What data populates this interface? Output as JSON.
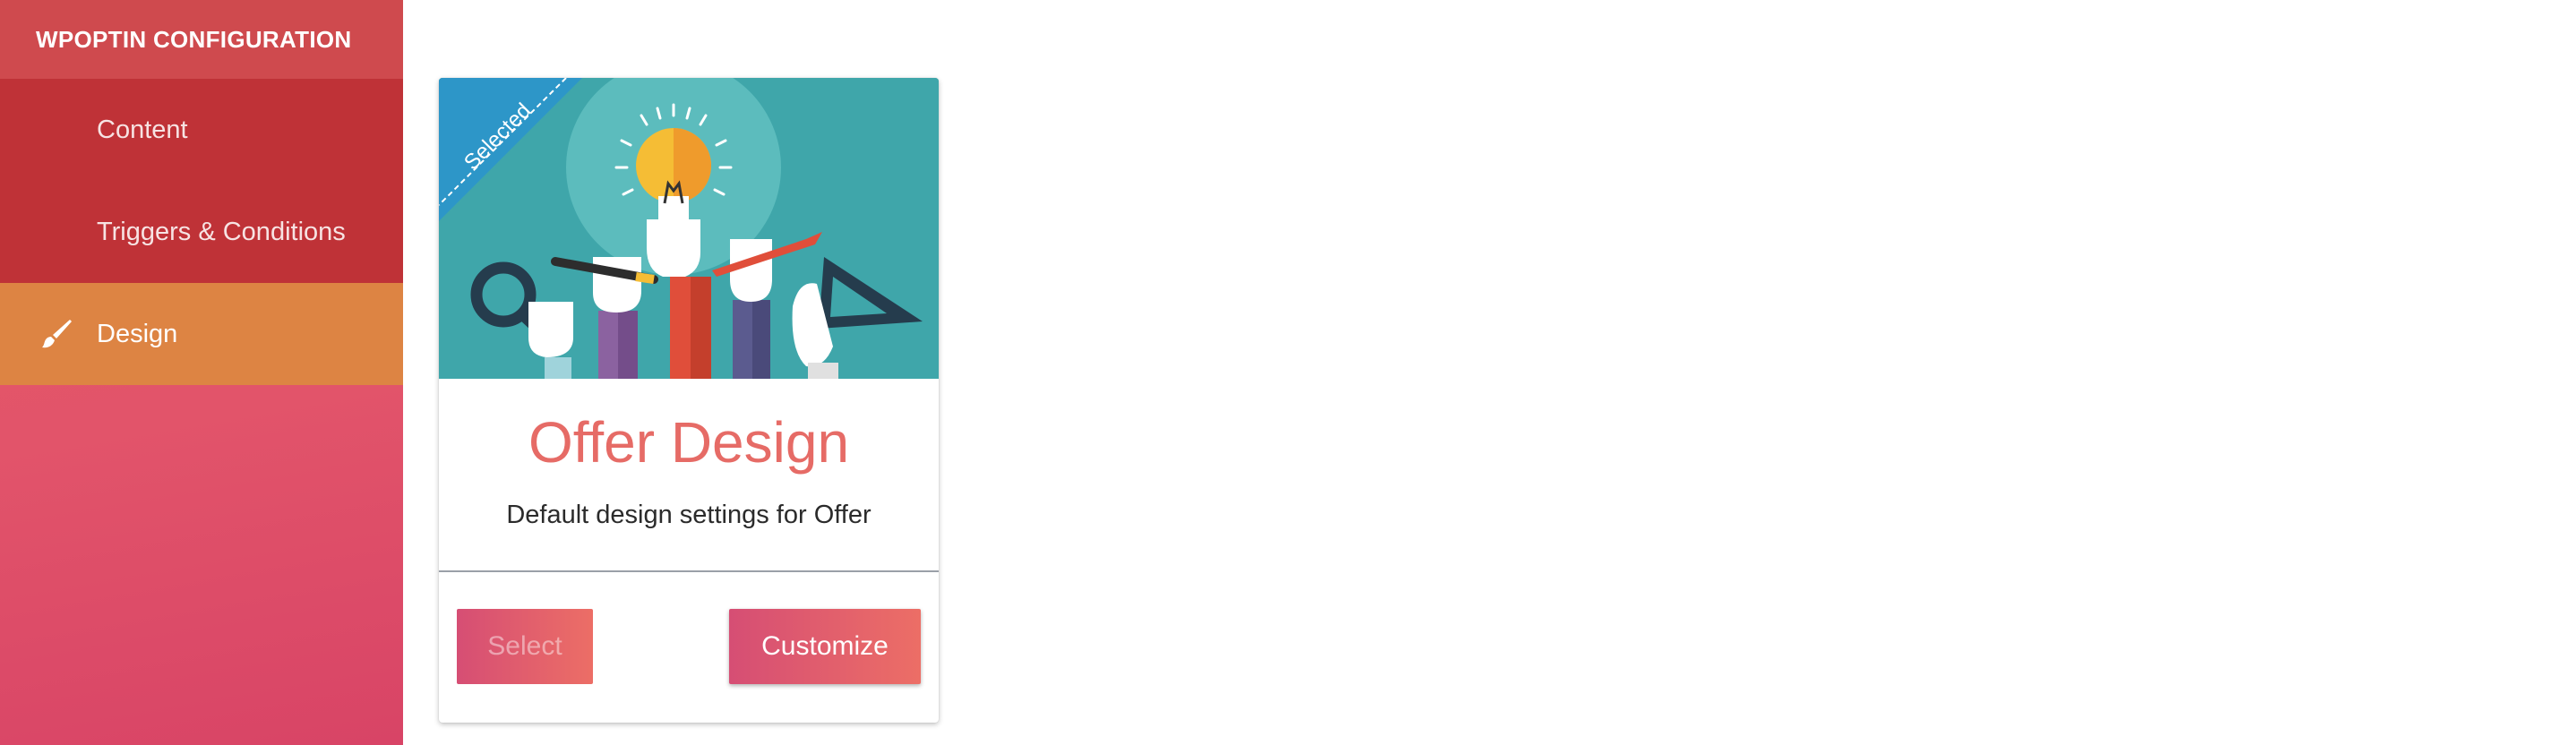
{
  "sidebar": {
    "header": "WPOPTIN CONFIGURATION",
    "items": [
      {
        "label": "Content",
        "active": false
      },
      {
        "label": "Triggers & Conditions",
        "active": false
      },
      {
        "label": "Design",
        "active": true,
        "icon": "paintbrush-icon"
      }
    ]
  },
  "card": {
    "ribbon": "Selected",
    "title": "Offer Design",
    "subtitle": "Default design settings for Offer",
    "select_label": "Select",
    "customize_label": "Customize"
  },
  "colors": {
    "sidebar_header": "#cf4a4e",
    "sidebar_sub": "#bf3237",
    "active_item": "#dd8443",
    "accent_title": "#e66b66",
    "media_bg": "#3fa6aa"
  }
}
